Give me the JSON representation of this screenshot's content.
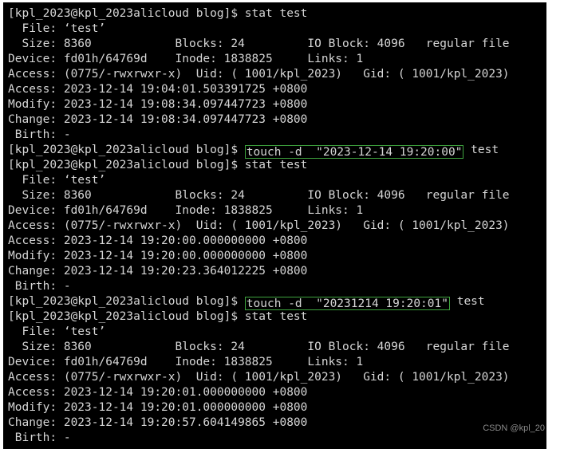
{
  "terminal": {
    "background_color": "#000000",
    "text_color": "#d6d6d6",
    "highlight_border_color": "#3ea33e",
    "prompt": "[kpl_2023@kpl_2023alicloud blog]$ ",
    "lines": [
      {
        "text": "[kpl_2023@kpl_2023alicloud blog]$ stat test"
      },
      {
        "text": "  File: ‘test’"
      },
      {
        "text": "  Size: 8360            Blocks: 24         IO Block: 4096   regular file"
      },
      {
        "text": "Device: fd01h/64769d    Inode: 1838825     Links: 1"
      },
      {
        "text": "Access: (0775/-rwxrwxr-x)  Uid: ( 1001/kpl_2023)   Gid: ( 1001/kpl_2023)"
      },
      {
        "text": "Access: 2023-12-14 19:04:01.503391725 +0800"
      },
      {
        "text": "Modify: 2023-12-14 19:08:34.097447723 +0800"
      },
      {
        "text": "Change: 2023-12-14 19:08:34.097447723 +0800"
      },
      {
        "text": " Birth: -"
      },
      {
        "prefix": "[kpl_2023@kpl_2023alicloud blog]$ ",
        "boxed": "touch -d  \"2023-12-14 19:20:00\"",
        "suffix": " test"
      },
      {
        "text": "[kpl_2023@kpl_2023alicloud blog]$ stat test"
      },
      {
        "text": "  File: ‘test’"
      },
      {
        "text": "  Size: 8360            Blocks: 24         IO Block: 4096   regular file"
      },
      {
        "text": "Device: fd01h/64769d    Inode: 1838825     Links: 1"
      },
      {
        "text": "Access: (0775/-rwxrwxr-x)  Uid: ( 1001/kpl_2023)   Gid: ( 1001/kpl_2023)"
      },
      {
        "text": "Access: 2023-12-14 19:20:00.000000000 +0800"
      },
      {
        "text": "Modify: 2023-12-14 19:20:00.000000000 +0800"
      },
      {
        "text": "Change: 2023-12-14 19:20:23.364012225 +0800"
      },
      {
        "text": " Birth: -"
      },
      {
        "prefix": "[kpl_2023@kpl_2023alicloud blog]$ ",
        "boxed": "touch -d  \"20231214 19:20:01\"",
        "suffix": " test"
      },
      {
        "text": "[kpl_2023@kpl_2023alicloud blog]$ stat test"
      },
      {
        "text": "  File: ‘test’"
      },
      {
        "text": "  Size: 8360            Blocks: 24         IO Block: 4096   regular file"
      },
      {
        "text": "Device: fd01h/64769d    Inode: 1838825     Links: 1"
      },
      {
        "text": "Access: (0775/-rwxrwxr-x)  Uid: ( 1001/kpl_2023)   Gid: ( 1001/kpl_2023)"
      },
      {
        "text": "Access: 2023-12-14 19:20:01.000000000 +0800"
      },
      {
        "text": "Modify: 2023-12-14 19:20:01.000000000 +0800"
      },
      {
        "text": "Change: 2023-12-14 19:20:57.604149865 +0800"
      },
      {
        "text": " Birth: -"
      }
    ]
  },
  "watermark": {
    "text": "CSDN @kpl_20",
    "color": "#8a8a8a"
  }
}
